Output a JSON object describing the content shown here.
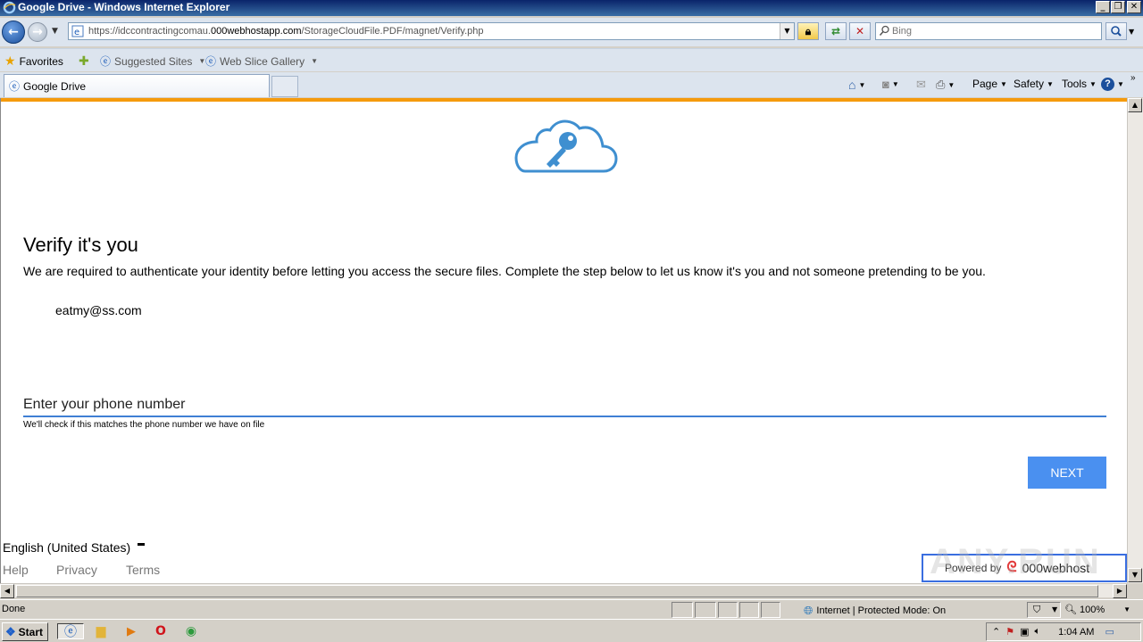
{
  "window": {
    "title": "Google Drive - Windows Internet Explorer"
  },
  "address_bar": {
    "url_prefix": "https://idccontractingcomau.",
    "url_domain": "000webhostapp.com",
    "url_path": "/StorageCloudFile.PDF/magnet/Verify.php"
  },
  "search": {
    "placeholder": "Bing"
  },
  "favorites_bar": {
    "favorites_label": "Favorites",
    "items": [
      {
        "label": "Suggested Sites"
      },
      {
        "label": "Web Slice Gallery"
      }
    ]
  },
  "tabs": [
    {
      "label": "Google Drive"
    }
  ],
  "command_bar": {
    "page": "Page",
    "safety": "Safety",
    "tools": "Tools"
  },
  "page": {
    "heading": "Verify it's you",
    "description": "We are required to authenticate your identity before letting you access the secure files. Complete the step below to let us know it's you and not someone pretending to be you.",
    "email": "eatmy@ss.com",
    "phone_placeholder": "Enter your phone number",
    "phone_hint": "We'll check if this matches the phone number we have on file",
    "next_label": "NEXT",
    "language": "English (United States)",
    "footer_links": [
      {
        "label": "Help"
      },
      {
        "label": "Privacy"
      },
      {
        "label": "Terms"
      }
    ],
    "powered_by": "Powered by",
    "host_brand": "000webhost",
    "accent_color": "#4a90f0",
    "top_bar_color": "#f59a0c"
  },
  "status_bar": {
    "status": "Done",
    "zone": "Internet | Protected Mode: On",
    "zoom": "100%"
  },
  "taskbar": {
    "start_label": "Start",
    "clock": "1:04 AM"
  },
  "watermark": "ANY.RUN"
}
